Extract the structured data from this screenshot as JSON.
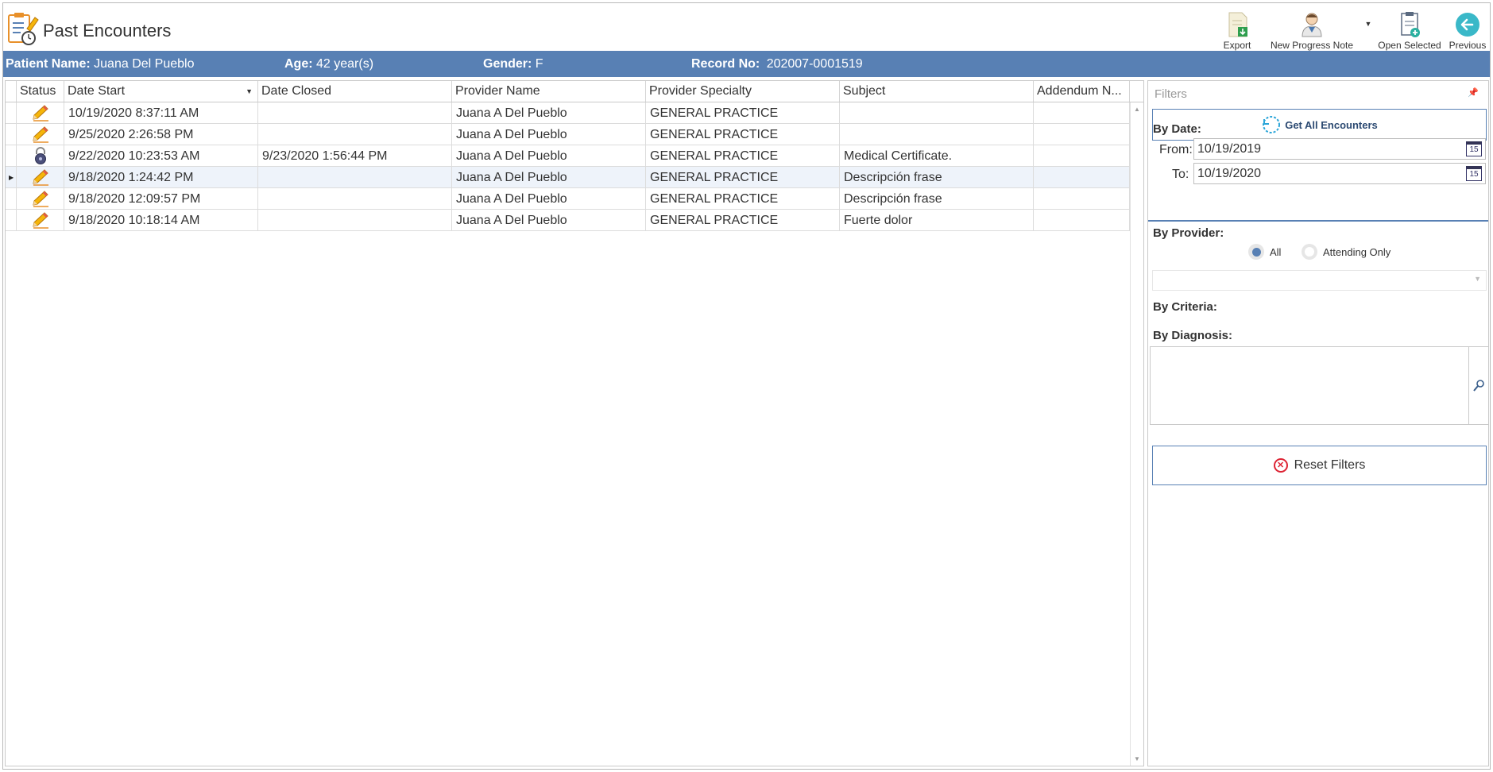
{
  "window": {
    "title": "Past Encounters"
  },
  "toolbar": {
    "export_label": "Export",
    "new_progress_note_label": "New Progress Note",
    "open_selected_label": "Open Selected",
    "previous_label": "Previous"
  },
  "patient": {
    "name_label": "Patient Name:",
    "name_value": "Juana Del Pueblo",
    "age_label": "Age:",
    "age_value": "42 year(s)",
    "gender_label": "Gender:",
    "gender_value": "F",
    "record_label": "Record No:",
    "record_value": "202007-0001519"
  },
  "grid": {
    "columns": [
      "Status",
      "Date Start",
      "Date Closed",
      "Provider Name",
      "Provider Specialty",
      "Subject",
      "Addendum N..."
    ],
    "rows": [
      {
        "status": "pencil-icon",
        "date_start": "10/19/2020 8:37:11 AM",
        "date_closed": "",
        "provider": "Juana A Del Pueblo",
        "specialty": "GENERAL PRACTICE",
        "subject": "",
        "addendum": ""
      },
      {
        "status": "pencil-icon",
        "date_start": "9/25/2020 2:26:58 PM",
        "date_closed": "",
        "provider": "Juana A Del Pueblo",
        "specialty": "GENERAL PRACTICE",
        "subject": "",
        "addendum": ""
      },
      {
        "status": "lock-icon",
        "date_start": "9/22/2020 10:23:53 AM",
        "date_closed": "9/23/2020 1:56:44 PM",
        "provider": "Juana A Del Pueblo",
        "specialty": "GENERAL PRACTICE",
        "subject": "Medical Certificate.",
        "addendum": ""
      },
      {
        "status": "pencil-icon",
        "date_start": "9/18/2020 1:24:42 PM",
        "date_closed": "",
        "provider": "Juana A Del Pueblo",
        "specialty": "GENERAL PRACTICE",
        "subject": "Descripción frase",
        "addendum": ""
      },
      {
        "status": "pencil-icon",
        "date_start": "9/18/2020 12:09:57 PM",
        "date_closed": "",
        "provider": "Juana A Del Pueblo",
        "specialty": "GENERAL PRACTICE",
        "subject": "Descripción frase",
        "addendum": ""
      },
      {
        "status": "pencil-icon",
        "date_start": "9/18/2020 10:18:14 AM",
        "date_closed": "",
        "provider": "Juana A Del Pueblo",
        "specialty": "GENERAL PRACTICE",
        "subject": "Fuerte dolor",
        "addendum": ""
      }
    ],
    "selected_row": 3
  },
  "filters": {
    "title": "Filters",
    "get_all_label": "Get All Encounters",
    "by_date_label": "By Date:",
    "from_label": "From:",
    "from_value": "10/19/2019",
    "to_label": "To:",
    "to_value": "10/19/2020",
    "calendar_day": "15",
    "by_provider_label": "By Provider:",
    "provider_options": [
      "All",
      "Attending Only"
    ],
    "provider_selected": "All",
    "by_criteria_label": "By Criteria:",
    "by_diagnosis_label": "By Diagnosis:",
    "reset_label": "Reset Filters"
  },
  "colors": {
    "accent": "#5880b4",
    "selected_row": "#eef3fa",
    "reset_icon": "#dd2233",
    "refresh_icon": "#2aa5d8"
  }
}
